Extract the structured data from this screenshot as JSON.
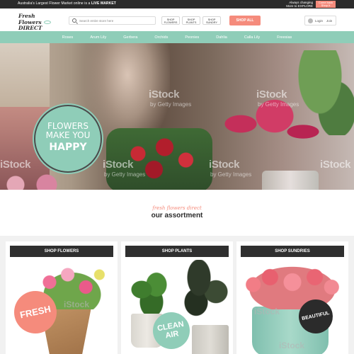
{
  "topbar": {
    "text_prefix": "Australia's Largest Flower Market online is a ",
    "text_bold": "LIVE MARKET",
    "right_line1": "Always changing",
    "right_line2": "More to EXPLORE",
    "cta_line1": "Come back",
    "cta_line2": "Shop It"
  },
  "header": {
    "logo_line1": "Fresh Flowers",
    "logo_line2": "DIRECT",
    "search_placeholder": "Search entire store here",
    "shop_nav": [
      {
        "line1": "SHOP",
        "line2": "FLOWERS"
      },
      {
        "line1": "SHOP",
        "line2": "PLANTS"
      },
      {
        "line1": "SHOP",
        "line2": "SUNDRY"
      }
    ],
    "shop_all": "SHOP ALL",
    "login": "Login",
    "join": "Join"
  },
  "nav": [
    "Roses",
    "Arum Lily",
    "Gerbera",
    "Orchids",
    "Peonies",
    "Dahlia",
    "Calla Lily",
    "Freesias"
  ],
  "hero": {
    "badge_line1": "FLOWERS",
    "badge_line2": "MAKE YOU",
    "badge_line3": "HAPPY",
    "watermark": "iStock",
    "watermark_sub": "by Getty Images"
  },
  "section": {
    "tagline": "fresh flowers direct",
    "heading": "our assortment"
  },
  "cards": [
    {
      "title": "SHOP FLOWERS",
      "badge": "FRESH"
    },
    {
      "title": "SHOP PLANTS",
      "badge_line1": "CLEAN",
      "badge_line2": "AIR"
    },
    {
      "title": "SHOP SUNDRIES",
      "badge": "BEAUTIFUL"
    }
  ],
  "colors": {
    "mint": "#8fcdb8",
    "coral": "#f58b7c",
    "dark": "#2b2b2b"
  }
}
